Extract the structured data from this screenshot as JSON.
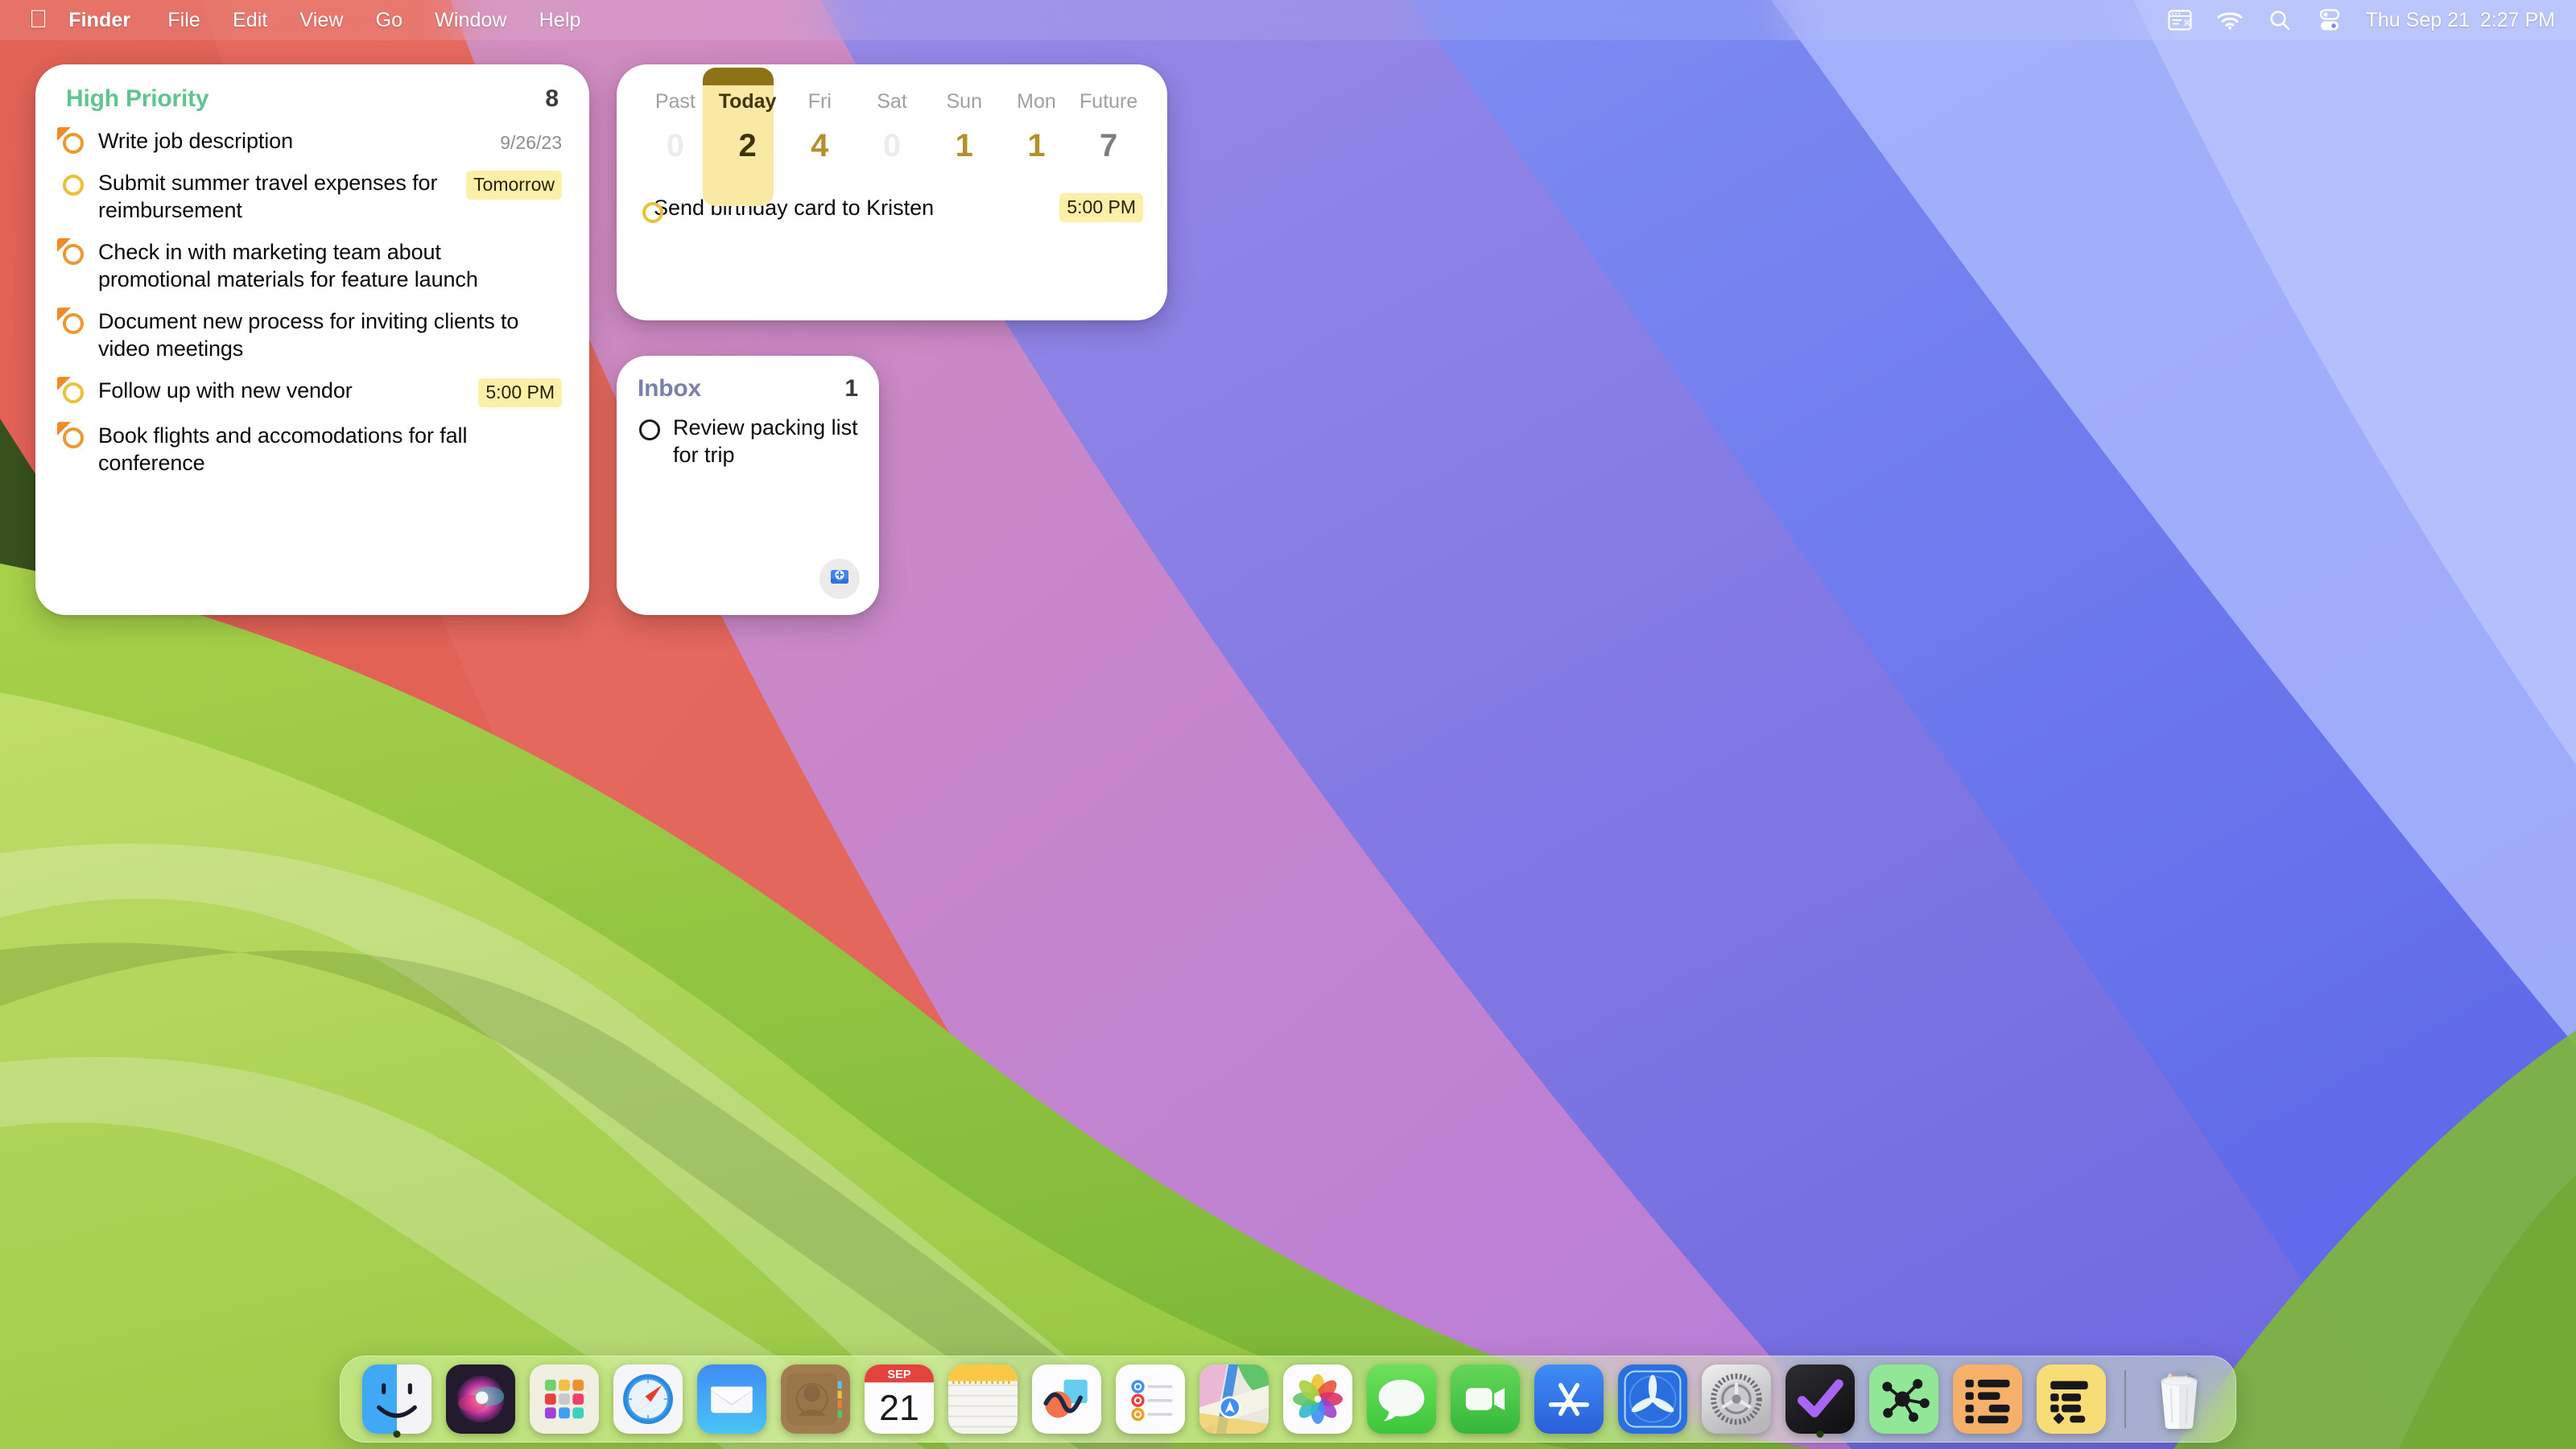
{
  "menubar": {
    "apple_glyph": "",
    "items": [
      {
        "label": "Finder",
        "bold": true
      },
      {
        "label": "File",
        "bold": false
      },
      {
        "label": "Edit",
        "bold": false
      },
      {
        "label": "View",
        "bold": false
      },
      {
        "label": "Go",
        "bold": false
      },
      {
        "label": "Window",
        "bold": false
      },
      {
        "label": "Help",
        "bold": false
      }
    ],
    "status_icons": [
      "keyboard-shortcuts-icon",
      "wifi-icon",
      "spotlight-search-icon",
      "control-center-icon"
    ],
    "date": "Thu Sep 21",
    "time": "2:27 PM"
  },
  "widgets": {
    "high_priority": {
      "title": "High Priority",
      "title_color": "#5fc490",
      "count": "8",
      "tasks": [
        {
          "text": "Write job description",
          "meta": "9/26/23",
          "meta_style": "plain",
          "check": "orange-flag"
        },
        {
          "text": "Submit summer travel expenses for reimbursement",
          "meta": "Tomorrow",
          "meta_style": "badge",
          "check": "yellow"
        },
        {
          "text": "Check in with marketing team about promotional materials for feature launch",
          "meta": "",
          "meta_style": "none",
          "check": "orange-flag"
        },
        {
          "text": "Document new process for inviting clients to video meetings",
          "meta": "",
          "meta_style": "none",
          "check": "orange-flag"
        },
        {
          "text": "Follow up with new vendor",
          "meta": "5:00 PM",
          "meta_style": "badge",
          "check": "yellow-flag"
        },
        {
          "text": "Book flights and accomodations for fall conference",
          "meta": "",
          "meta_style": "none",
          "check": "orange-flag"
        }
      ]
    },
    "forecast": {
      "columns": [
        {
          "label": "Past",
          "count": "0",
          "style": "zero"
        },
        {
          "label": "Today",
          "count": "2",
          "style": "today"
        },
        {
          "label": "Fri",
          "count": "4",
          "style": "gold"
        },
        {
          "label": "Sat",
          "count": "0",
          "style": "zero"
        },
        {
          "label": "Sun",
          "count": "1",
          "style": "gold"
        },
        {
          "label": "Mon",
          "count": "1",
          "style": "gold"
        },
        {
          "label": "Future",
          "count": "7",
          "style": "future"
        }
      ],
      "task": {
        "text": "Send birthday card to Kristen",
        "badge": "5:00 PM",
        "check": "yellow"
      }
    },
    "inbox": {
      "title": "Inbox",
      "title_color": "#7b7fae",
      "count": "1",
      "tasks": [
        {
          "text": "Review packing list for trip",
          "check": "black"
        }
      ],
      "add_button_icon": "inbox-add-icon"
    }
  },
  "dock": {
    "items": [
      {
        "name": "finder",
        "label": "Finder",
        "running": true
      },
      {
        "name": "siri",
        "label": "Siri",
        "running": false
      },
      {
        "name": "launchpad",
        "label": "Launchpad",
        "running": false
      },
      {
        "name": "safari",
        "label": "Safari",
        "running": false
      },
      {
        "name": "mail",
        "label": "Mail",
        "running": false
      },
      {
        "name": "contacts",
        "label": "Contacts",
        "running": false
      },
      {
        "name": "calendar",
        "label": "Calendar",
        "running": false,
        "month": "SEP",
        "day": "21"
      },
      {
        "name": "notes",
        "label": "Notes",
        "running": false
      },
      {
        "name": "freeform",
        "label": "Freeform",
        "running": false
      },
      {
        "name": "reminders",
        "label": "Reminders",
        "running": false
      },
      {
        "name": "maps",
        "label": "Maps",
        "running": false
      },
      {
        "name": "photos",
        "label": "Photos",
        "running": false
      },
      {
        "name": "messages",
        "label": "Messages",
        "running": false
      },
      {
        "name": "facetime",
        "label": "FaceTime",
        "running": false
      },
      {
        "name": "app-store",
        "label": "App Store",
        "running": false
      },
      {
        "name": "keynote",
        "label": "Keynote",
        "running": false
      },
      {
        "name": "system-settings",
        "label": "System Settings",
        "running": false
      },
      {
        "name": "omnifocus",
        "label": "OmniFocus",
        "running": true
      },
      {
        "name": "omnigraffle",
        "label": "OmniGraffle",
        "running": false
      },
      {
        "name": "omniplan",
        "label": "OmniPlan",
        "running": false
      },
      {
        "name": "omnioutliner",
        "label": "OmniOutliner",
        "running": false
      }
    ],
    "trash": {
      "name": "trash",
      "label": "Trash"
    }
  }
}
